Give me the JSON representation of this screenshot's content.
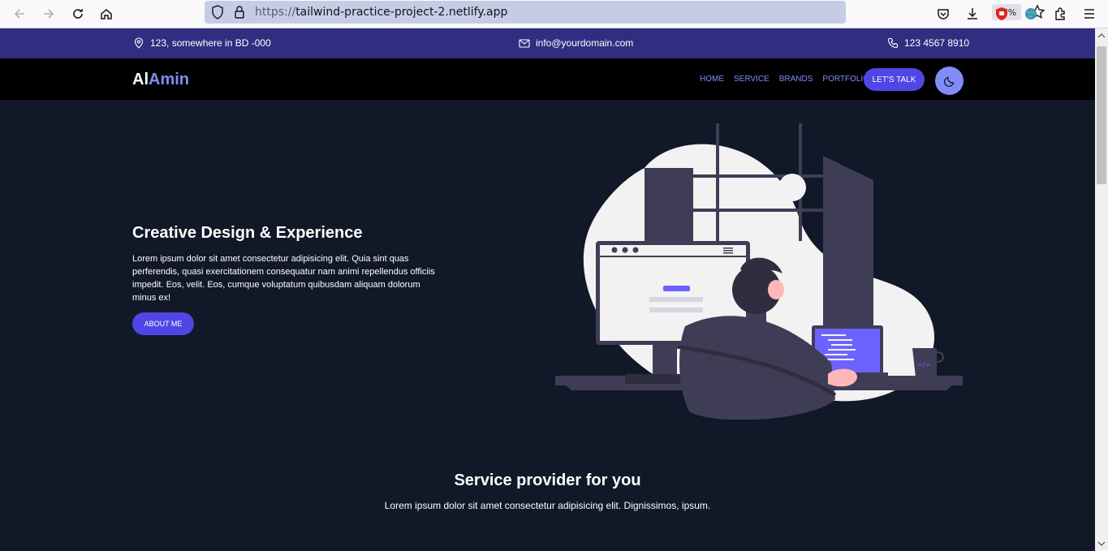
{
  "browser": {
    "url_scheme": "https://",
    "url_host": "tailwind-practice-project-2.netlify.app",
    "zoom": "67%"
  },
  "topbar": {
    "address": "123, somewhere in BD -000",
    "email": "info@yourdomain.com",
    "phone": "123 4567 8910"
  },
  "navbar": {
    "logo_part1": "Al",
    "logo_part2": "Amin",
    "links": [
      "HOME",
      "SERVICE",
      "BRANDS",
      "PORTFOLIO"
    ],
    "cta_label": "LET'S TALK"
  },
  "hero": {
    "title": "Creative Design & Experience",
    "text": "Lorem ipsum dolor sit amet consectetur adipisicing elit. Quia sint quas perferendis, quasi exercitationem consequatur nam animi repellendus officiis impedit. Eos, velit. Eos, cumque voluptatum quibusdam aliquam dolorum minus ex!",
    "button_label": "ABOUT ME"
  },
  "services": {
    "title": "Service provider for you",
    "text": "Lorem ipsum dolor sit amet consectetur adipisicing elit. Dignissimos, ipsum."
  },
  "colors": {
    "topbar": "#312e81",
    "accent": "#818cf8",
    "button": "#4f46e5",
    "background": "#111827"
  }
}
